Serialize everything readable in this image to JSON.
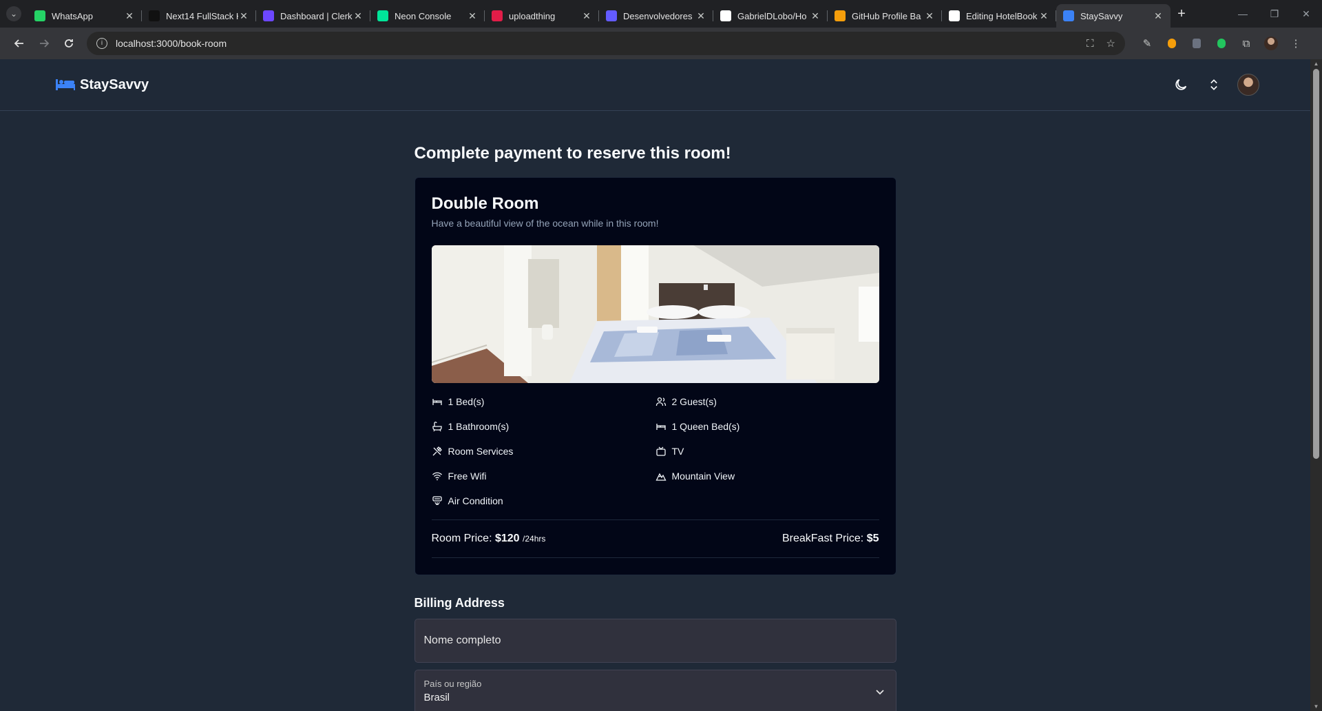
{
  "browser": {
    "tabs": [
      {
        "title": "WhatsApp",
        "icon": "whatsapp-icon",
        "color": "#25d366"
      },
      {
        "title": "Next14 FullStack H",
        "icon": "pitch-icon",
        "color": "#111111"
      },
      {
        "title": "Dashboard | Clerk",
        "icon": "clerk-icon",
        "color": "#6c47ff"
      },
      {
        "title": "Neon Console",
        "icon": "neon-icon",
        "color": "#00e599"
      },
      {
        "title": "uploadthing",
        "icon": "uploadthing-icon",
        "color": "#e11d48"
      },
      {
        "title": "Desenvolvedores",
        "icon": "stripe-icon",
        "color": "#635bff"
      },
      {
        "title": "GabrielDLobo/Ho",
        "icon": "github-icon",
        "color": "#ffffff"
      },
      {
        "title": "GitHub Profile Ba",
        "icon": "badge-icon",
        "color": "#f59e0b"
      },
      {
        "title": "Editing HotelBook",
        "icon": "github-icon",
        "color": "#ffffff"
      },
      {
        "title": "StaySavvy",
        "icon": "bed-icon",
        "color": "#3b82f6"
      }
    ],
    "url_host": "localhost:3000",
    "url_path": "/book-room"
  },
  "app": {
    "brand": "StaySavvy",
    "page_title": "Complete payment to reserve this room!"
  },
  "room": {
    "title": "Double Room",
    "description": "Have a beautiful view of the ocean while in this room!",
    "amenities": [
      {
        "label": "1 Bed(s)",
        "icon": "bed-icon"
      },
      {
        "label": "2 Guest(s)",
        "icon": "users-icon"
      },
      {
        "label": "1 Bathroom(s)",
        "icon": "bath-icon"
      },
      {
        "label": "1 Queen Bed(s)",
        "icon": "bed-icon"
      },
      {
        "label": "Room Services",
        "icon": "utensils-crossed-icon"
      },
      {
        "label": "TV",
        "icon": "tv-icon"
      },
      {
        "label": "Free Wifi",
        "icon": "wifi-icon"
      },
      {
        "label": "Mountain View",
        "icon": "mountain-icon"
      },
      {
        "label": "Air Condition",
        "icon": "air-vent-icon"
      }
    ],
    "room_price_label": "Room Price:",
    "room_price_value": "$120",
    "room_price_unit": "/24hrs",
    "breakfast_price_label": "BreakFast Price:",
    "breakfast_price_value": "$5"
  },
  "billing": {
    "title": "Billing Address",
    "full_name_placeholder": "Nome completo",
    "country_label": "País ou região",
    "country_value": "Brasil"
  }
}
